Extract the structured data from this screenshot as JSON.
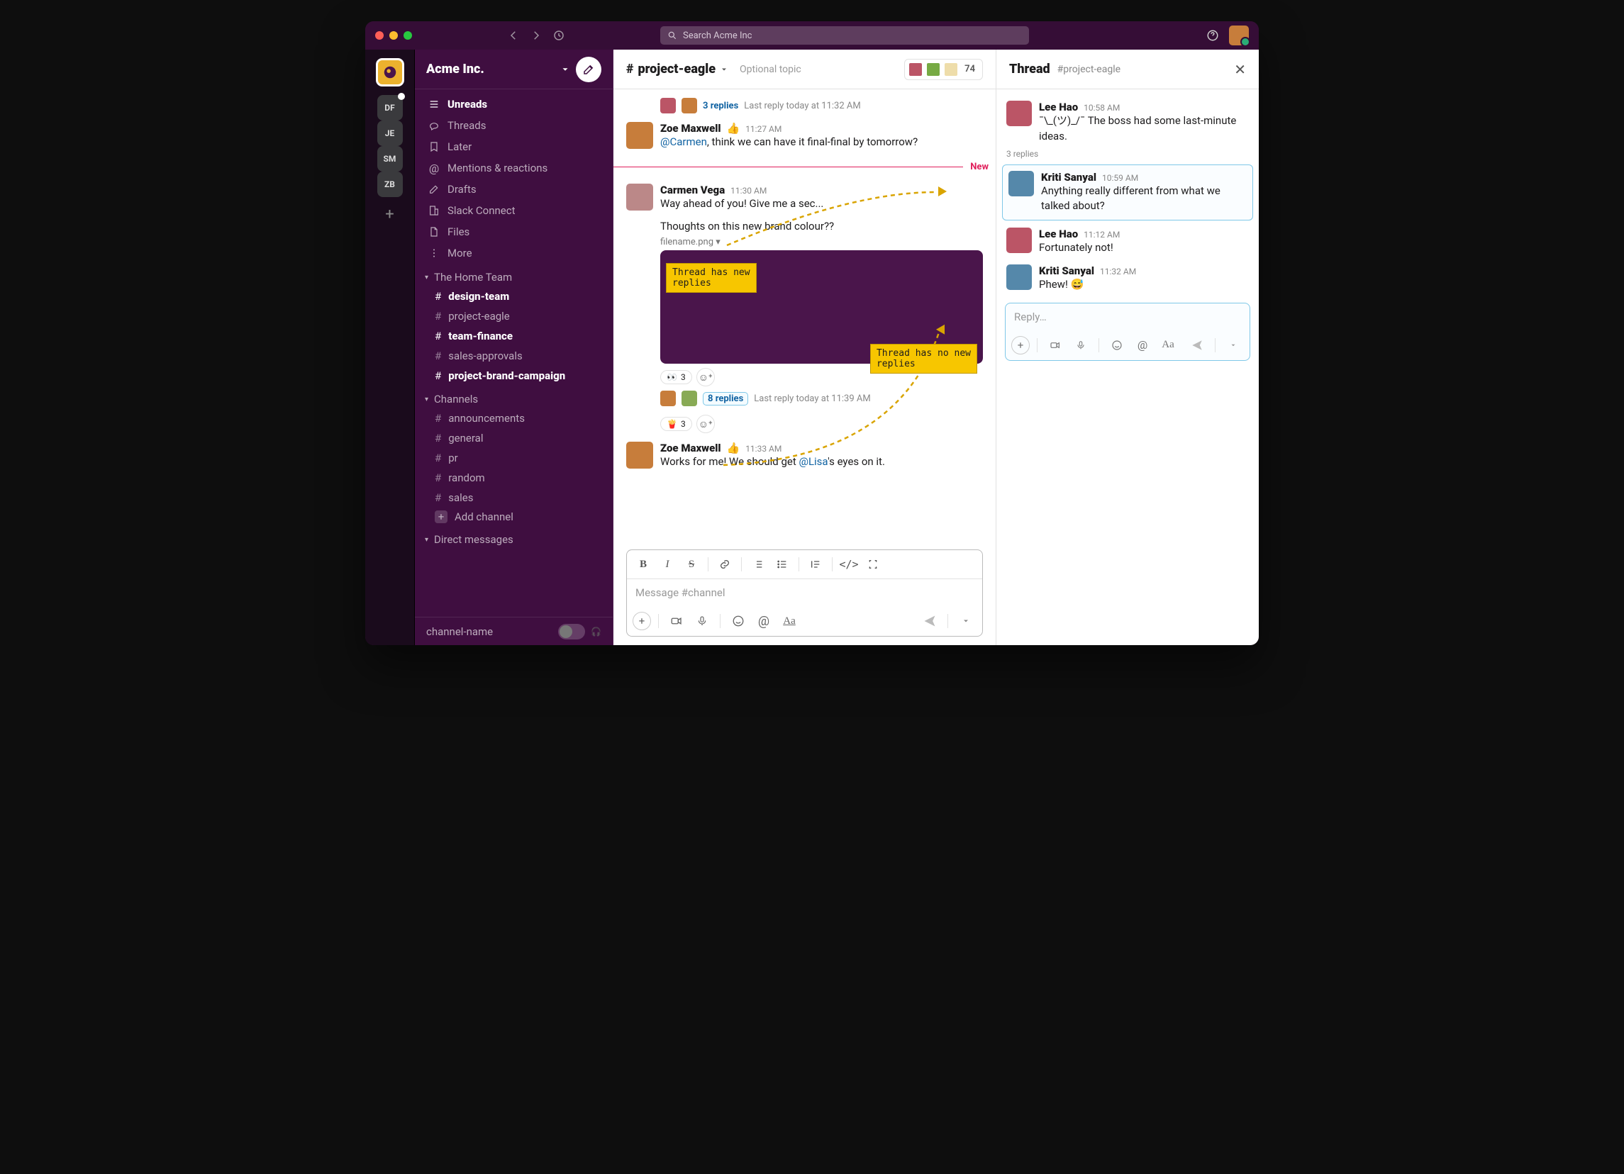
{
  "search_placeholder": "Search Acme Inc",
  "workspace": {
    "name": "Acme Inc."
  },
  "rail": {
    "items": [
      {
        "label": "DF",
        "has_badge": true
      },
      {
        "label": "JE"
      },
      {
        "label": "SM"
      },
      {
        "label": "ZB"
      }
    ]
  },
  "sidebar": {
    "nav": [
      {
        "icon": "≣",
        "label": "Unreads",
        "bold": true
      },
      {
        "icon": "thread",
        "label": "Threads"
      },
      {
        "icon": "bookmark",
        "label": "Later"
      },
      {
        "icon": "at",
        "label": "Mentions & reactions"
      },
      {
        "icon": "pencil",
        "label": "Drafts"
      },
      {
        "icon": "building",
        "label": "Slack Connect"
      },
      {
        "icon": "file",
        "label": "Files"
      },
      {
        "icon": "more",
        "label": "More"
      }
    ],
    "sections": [
      {
        "name": "The Home Team",
        "items": [
          {
            "name": "design-team",
            "bold": true
          },
          {
            "name": "project-eagle"
          },
          {
            "name": "team-finance",
            "bold": true
          },
          {
            "name": "sales-approvals"
          },
          {
            "name": "project-brand-campaign",
            "bold": true
          }
        ]
      },
      {
        "name": "Channels",
        "items": [
          {
            "name": "announcements"
          },
          {
            "name": "general"
          },
          {
            "name": "pr"
          },
          {
            "name": "random"
          },
          {
            "name": "sales"
          }
        ],
        "add": "Add channel"
      },
      {
        "name": "Direct messages",
        "items": []
      }
    ],
    "footer_channel": "channel-name"
  },
  "channel": {
    "name": "project-eagle",
    "topic": "Optional topic",
    "members": "74",
    "composer_placeholder": "Message #channel",
    "new_label": "New"
  },
  "messages": [
    {
      "type": "replies",
      "count": "3 replies",
      "meta": "Last reply today at 11:32 AM"
    },
    {
      "type": "msg",
      "name": "Zoe Maxwell",
      "emoji": "👍",
      "time": "11:27 AM",
      "text_pre": "",
      "mention": "@Carmen",
      "text_post": ", think we can have it final-final by tomorrow?",
      "avatar": "#c77d3b"
    },
    {
      "type": "new"
    },
    {
      "type": "msg",
      "name": "Carmen Vega",
      "time": "11:30 AM",
      "text": "Way ahead of you! Give me a sec...",
      "react": [
        {
          "e": "🍟",
          "n": "3"
        }
      ],
      "avatar": "#b88",
      "then": {
        "text": "Thoughts on this new brand colour??",
        "file": "filename.png",
        "img": true,
        "react2": [
          {
            "e": "👀",
            "n": "3"
          }
        ],
        "replies": {
          "count": "8 replies",
          "meta": "Last reply today at 11:39 AM",
          "box": true
        }
      }
    },
    {
      "type": "msg",
      "name": "Zoe Maxwell",
      "emoji": "👍",
      "time": "11:33 AM",
      "text_pre": "Works for me! We should get ",
      "mention": "@Lisa",
      "text_post": "'s eyes on it.",
      "avatar": "#c77d3b"
    }
  ],
  "annotations": {
    "a1": "Thread has new\nreplies",
    "a2": "Thread has no new\nreplies"
  },
  "thread": {
    "title": "Thread",
    "sub": "#project-eagle",
    "reply_count": "3 replies",
    "reply_placeholder": "Reply…",
    "items": [
      {
        "name": "Lee Hao",
        "time": "10:58 AM",
        "text": "¯\\_(ツ)_/¯ The boss had some last-minute ideas.",
        "avatar": "#b56"
      },
      {
        "name": "Kriti Sanyal",
        "time": "10:59 AM",
        "text": "Anything really different from what we talked about?",
        "hl": true,
        "avatar": "#58a"
      },
      {
        "name": "Lee Hao",
        "time": "11:12 AM",
        "text": "Fortunately not!",
        "avatar": "#b56"
      },
      {
        "name": "Kriti Sanyal",
        "time": "11:32 AM",
        "text": "Phew! 😅",
        "avatar": "#58a"
      }
    ]
  }
}
